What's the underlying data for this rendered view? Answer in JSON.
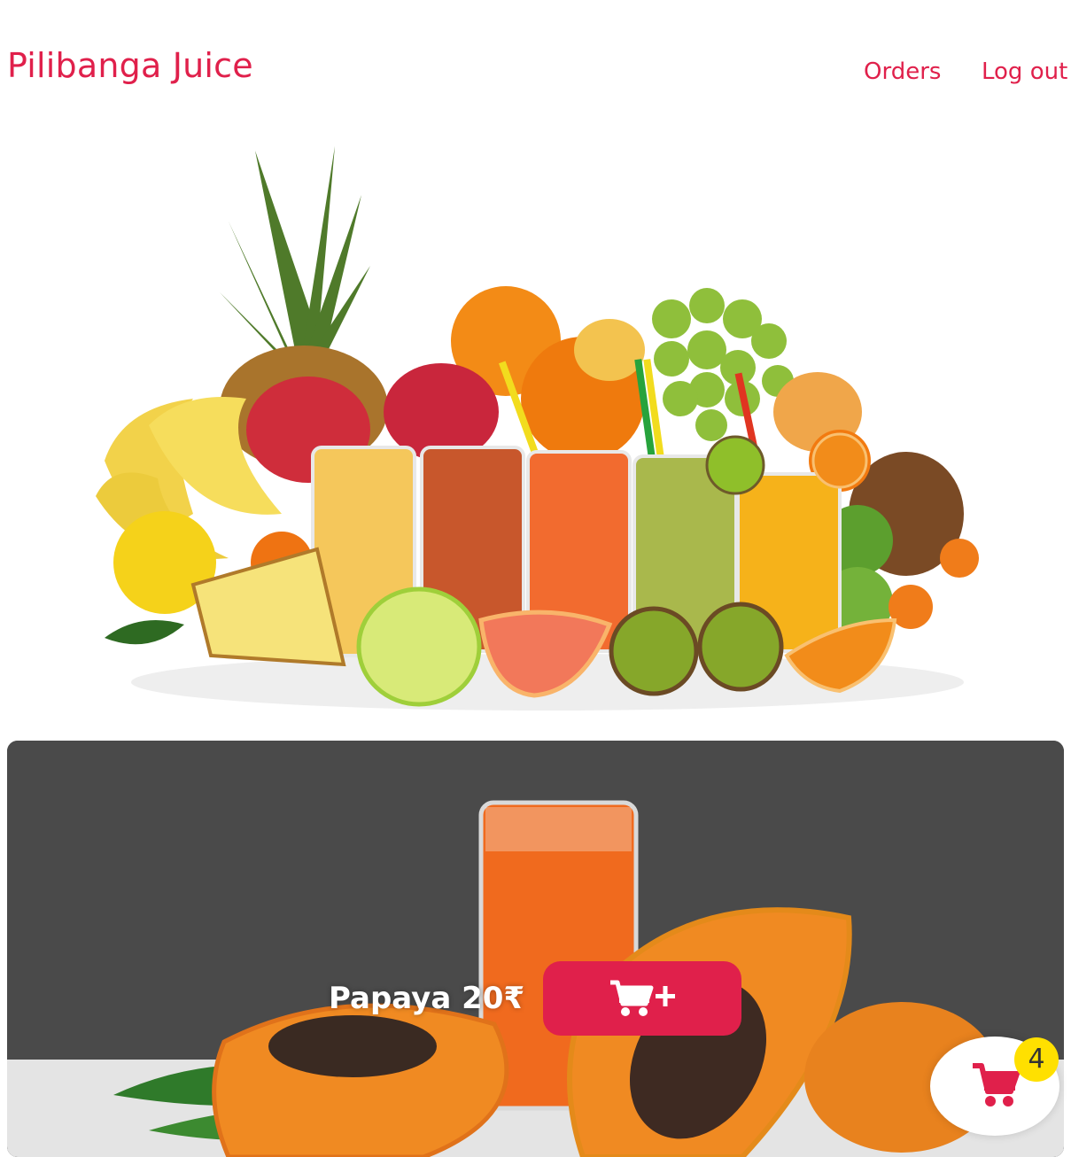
{
  "header": {
    "brand": "Pilibanga Juice",
    "nav": [
      {
        "label": "Orders"
      },
      {
        "label": "Log out"
      }
    ]
  },
  "colors": {
    "accent": "#e0204b",
    "badge": "#ffe000",
    "card_bg": "#4a4a4a"
  },
  "product": {
    "label": "Papaya 20₹",
    "add_button_icon": "cart-plus-icon"
  },
  "cart": {
    "icon": "shopping-cart-icon",
    "count": "4"
  }
}
